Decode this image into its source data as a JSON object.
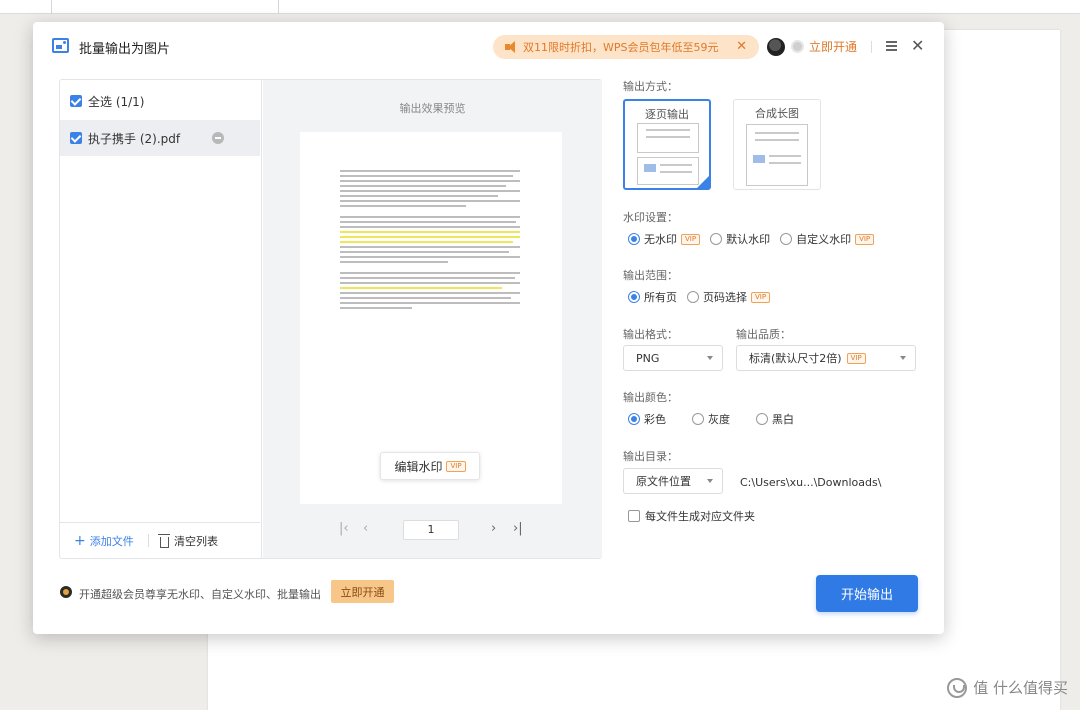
{
  "dialog": {
    "title": "批量输出为图片",
    "promo_banner": "双11限时折扣，WPS会员包年低至59元",
    "open_now_label": "立即开通"
  },
  "file_list": {
    "select_all_label": "全选 (1/1)",
    "files": [
      {
        "name": "执子携手 (2).pdf",
        "checked": true
      }
    ],
    "add_file_label": "添加文件",
    "clear_list_label": "清空列表"
  },
  "preview": {
    "title": "输出效果预览",
    "edit_watermark_label": "编辑水印",
    "vip_tag": "VIP",
    "current_page": "1"
  },
  "settings": {
    "output_mode_label": "输出方式：",
    "modes": [
      {
        "label": "逐页输出",
        "selected": true
      },
      {
        "label": "合成长图",
        "selected": false
      }
    ],
    "watermark_label": "水印设置：",
    "watermark_options": [
      {
        "label": "无水印",
        "selected": true,
        "vip": true
      },
      {
        "label": "默认水印",
        "selected": false,
        "vip": false
      },
      {
        "label": "自定义水印",
        "selected": false,
        "vip": true
      }
    ],
    "range_label": "输出范围：",
    "range_options": [
      {
        "label": "所有页",
        "selected": true,
        "vip": false
      },
      {
        "label": "页码选择",
        "selected": false,
        "vip": true
      }
    ],
    "format_label": "输出格式：",
    "format_value": "PNG",
    "quality_label": "输出品质：",
    "quality_value": "标清(默认尺寸2倍)",
    "color_label": "输出颜色：",
    "color_options": [
      {
        "label": "彩色",
        "selected": true
      },
      {
        "label": "灰度",
        "selected": false
      },
      {
        "label": "黑白",
        "selected": false
      }
    ],
    "directory_label": "输出目录：",
    "directory_value": "原文件位置",
    "directory_path": "C:\\Users\\xu...\\Downloads\\",
    "subfolder_label": "每文件生成对应文件夹",
    "subfolder_checked": false
  },
  "footer": {
    "promo_text": "开通超级会员尊享无水印、自定义水印、批量输出",
    "open_button_label": "立即开通",
    "start_button_label": "开始输出"
  },
  "background": {
    "watermark_text": "值 什么值得买"
  },
  "colors": {
    "accent": "#2f7ae5",
    "promo_bg": "#fde3c7",
    "promo_text": "#e0792a",
    "highlight": "#f0e65a"
  }
}
